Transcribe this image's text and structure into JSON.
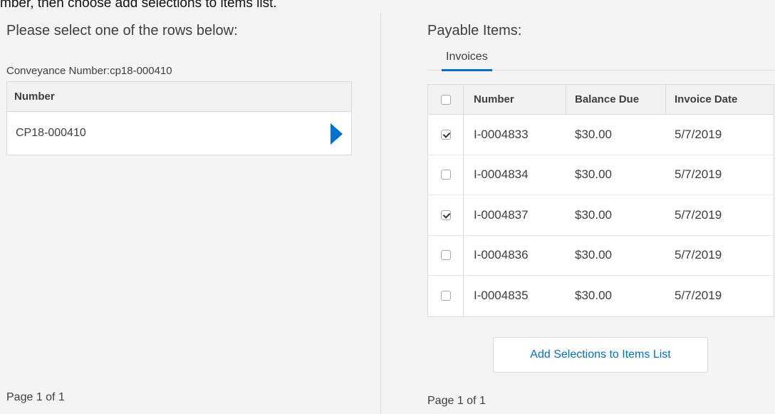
{
  "top_instruction": "mber, then choose add selections to items list.",
  "left": {
    "heading": "Please select one of the rows below:",
    "conveyance_label": "Conveyance Number:cp18-000410",
    "table": {
      "header": "Number",
      "rows": [
        {
          "number": "CP18-000410"
        }
      ]
    },
    "page": "Page 1 of 1"
  },
  "right": {
    "heading": "Payable Items:",
    "tabs": [
      {
        "label": "Invoices",
        "active": true
      }
    ],
    "table": {
      "headers": {
        "number": "Number",
        "balance": "Balance Due",
        "date": "Invoice Date"
      },
      "rows": [
        {
          "number": "I-0004833",
          "balance": "$30.00",
          "date": "5/7/2019",
          "checked": true
        },
        {
          "number": "I-0004834",
          "balance": "$30.00",
          "date": "5/7/2019",
          "checked": false
        },
        {
          "number": "I-0004837",
          "balance": "$30.00",
          "date": "5/7/2019",
          "checked": true
        },
        {
          "number": "I-0004836",
          "balance": "$30.00",
          "date": "5/7/2019",
          "checked": false
        },
        {
          "number": "I-0004835",
          "balance": "$30.00",
          "date": "5/7/2019",
          "checked": false
        }
      ]
    },
    "add_button_label": "Add Selections to Items List",
    "page": "Page 1 of 1"
  },
  "colors": {
    "accent": "#0070d2",
    "background": "#f4f4f4",
    "border": "#dddbda"
  },
  "icons": {
    "row_select": "triangle-right-icon",
    "checkbox": "checkbox-icon"
  }
}
